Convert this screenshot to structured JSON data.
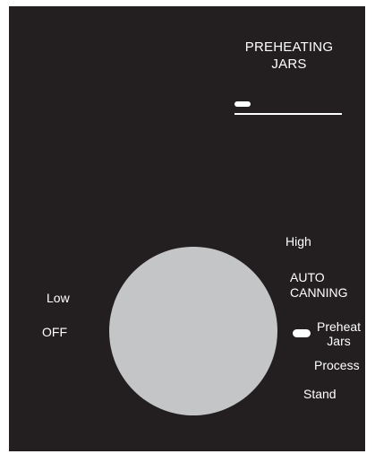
{
  "display": {
    "title": "PREHEATING\nJARS"
  },
  "dial": {
    "labels": {
      "high": "High",
      "auto_canning": "AUTO\nCANNING",
      "low": "Low",
      "off": "OFF",
      "preheat_jars": "Preheat\nJars",
      "process": "Process",
      "stand": "Stand"
    },
    "selected_setting": "Preheat Jars"
  },
  "colors": {
    "panel_background": "#231f20",
    "dial_knob": "#c4c5c7",
    "text": "#ffffff"
  }
}
